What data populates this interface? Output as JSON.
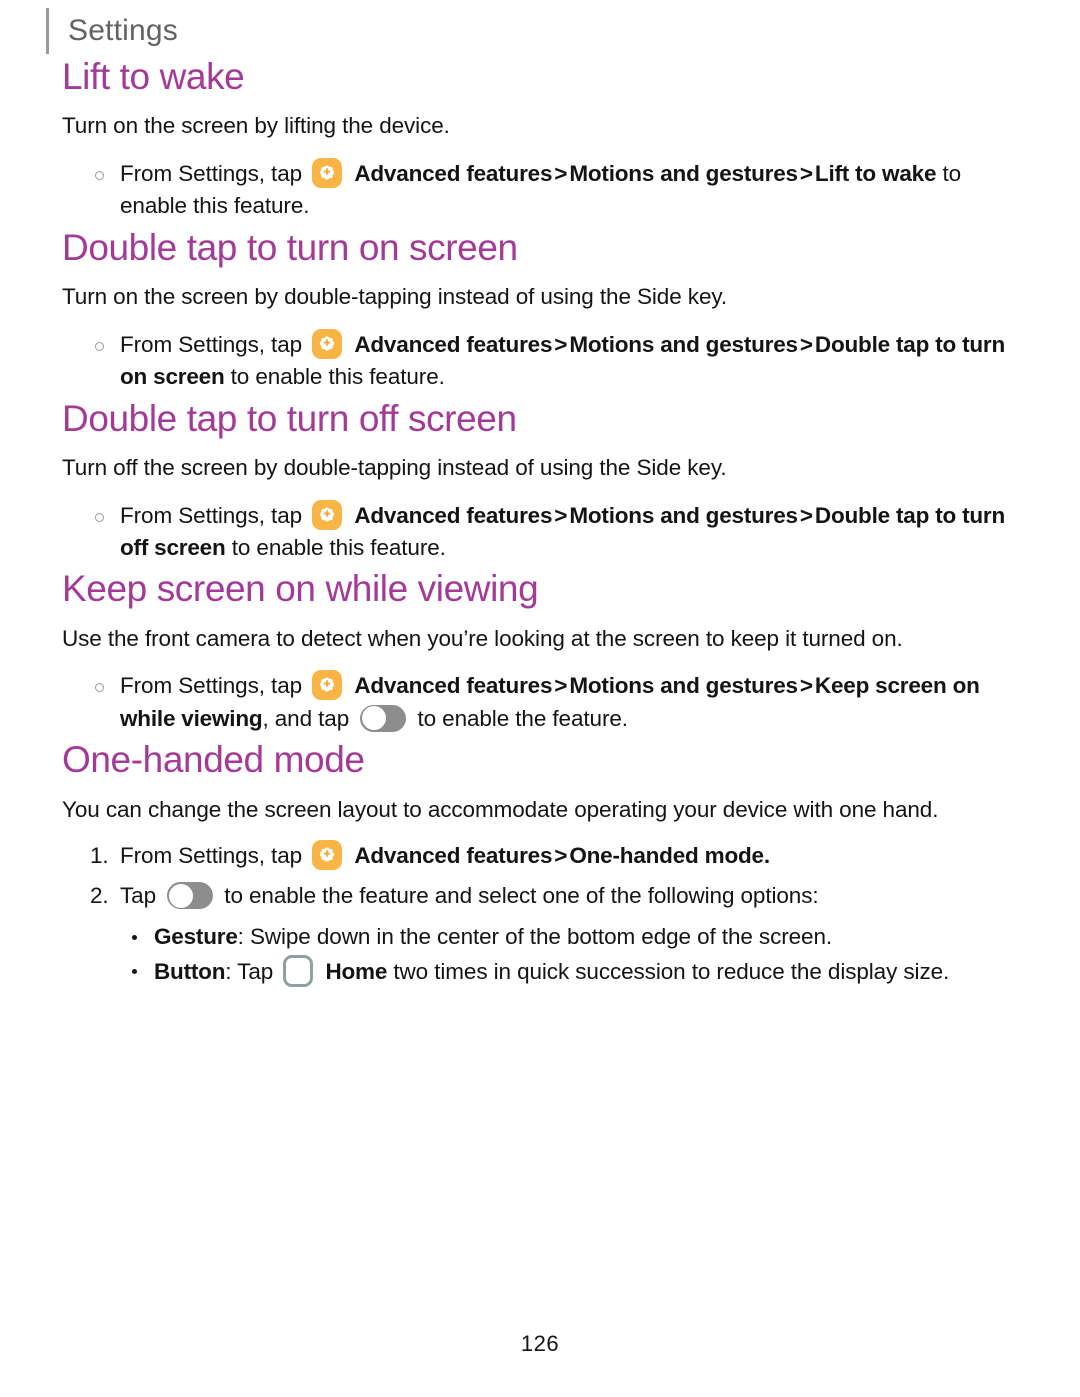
{
  "header": {
    "title": "Settings"
  },
  "colors": {
    "heading": "#a43a97",
    "header_text": "#636363",
    "rule": "#9a9a9a",
    "icon_badge_orange": "#f8b545",
    "toggle_track": "#8d8d8d",
    "home_key_outline": "#8ea0a0",
    "body_text": "#141414"
  },
  "icons": {
    "advanced_features": "advanced-features-gear-icon",
    "toggle": "toggle-switch-off-icon",
    "home": "home-key-icon",
    "bullet": "hollow-circle-bullet"
  },
  "sections": [
    {
      "heading": "Lift to wake",
      "intro": "Turn on the screen by lifting the device.",
      "steps": [
        {
          "lead": "From Settings, tap",
          "icon": "advanced-features-gear-icon",
          "bold1": "Advanced features",
          "sep1": ">",
          "bold2": "Motions and gestures",
          "sep2": ">",
          "bold3": "Lift to wake",
          "tail": "to enable this feature."
        }
      ]
    },
    {
      "heading": "Double tap to turn on screen",
      "intro": "Turn on the screen by double-tapping instead of using the Side key.",
      "steps": [
        {
          "lead": "From Settings, tap",
          "icon": "advanced-features-gear-icon",
          "bold1": "Advanced features",
          "sep1": ">",
          "bold2": "Motions and gestures",
          "sep2": ">",
          "bold3": "Double tap to turn on screen",
          "tail": "to enable this feature."
        }
      ]
    },
    {
      "heading": "Double tap to turn off screen",
      "intro": "Turn off the screen by double-tapping instead of using the Side key.",
      "steps": [
        {
          "lead": "From Settings, tap",
          "icon": "advanced-features-gear-icon",
          "bold1": "Advanced features",
          "sep1": ">",
          "bold2": "Motions and gestures",
          "sep2": ">",
          "bold3": "Double tap to turn off screen",
          "tail": "to enable this feature."
        }
      ]
    },
    {
      "heading": "Keep screen on while viewing",
      "intro": "Use the front camera to detect when you’re looking at the screen to keep it turned on.",
      "steps": [
        {
          "lead": "From Settings, tap",
          "icon": "advanced-features-gear-icon",
          "bold1": "Advanced features",
          "sep1": ">",
          "bold2": "Motions and gestures",
          "sep2": ">",
          "bold3": "Keep screen on while viewing",
          "mid": ", and tap",
          "icon2": "toggle-switch-off-icon",
          "tail": "to enable the feature."
        }
      ]
    },
    {
      "heading": "One-handed mode",
      "intro": "You can change the screen layout to accommodate operating your device with one hand.",
      "numbered": [
        {
          "number": "1.",
          "lead": "From Settings, tap",
          "icon": "advanced-features-gear-icon",
          "bold1": "Advanced features",
          "sep1": ">",
          "bold2": "One-handed mode."
        },
        {
          "number": "2.",
          "lead": "Tap",
          "icon": "toggle-switch-off-icon",
          "tail": "to enable the feature and select one of the following options:"
        }
      ],
      "options": [
        {
          "label": "Gesture",
          "text": ": Swipe down in the center of the bottom edge of the screen."
        },
        {
          "label": "Button",
          "text_before": ": Tap",
          "icon": "home-key-icon",
          "bold_after": "Home",
          "text_after": "two times in quick succession to reduce the display size."
        }
      ]
    }
  ],
  "footer": {
    "page_number": "126"
  }
}
